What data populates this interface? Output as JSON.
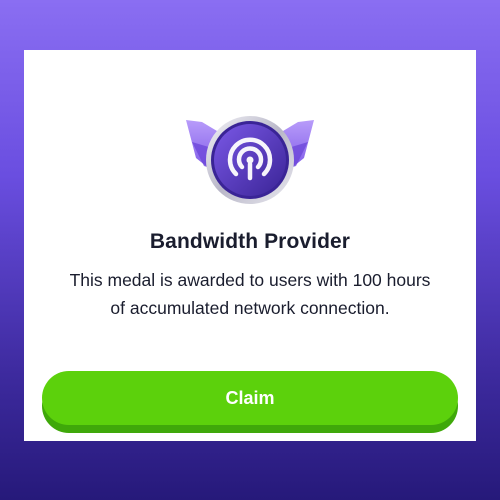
{
  "medal": {
    "icon": "broadcast-signal-icon",
    "title": "Bandwidth Provider",
    "description": "This medal is awarded to users with 100 hours of accumulated network connection."
  },
  "actions": {
    "claim_label": "Claim"
  },
  "colors": {
    "background_top": "#8a6ef2",
    "background_bottom": "#26197a",
    "card": "#ffffff",
    "claim_button": "#5cd10c",
    "claim_button_shadow": "#3fa80a",
    "medal_purple": "#5b3cc9",
    "medal_wing": "#9a7cf0",
    "text": "#1a1d2e"
  }
}
